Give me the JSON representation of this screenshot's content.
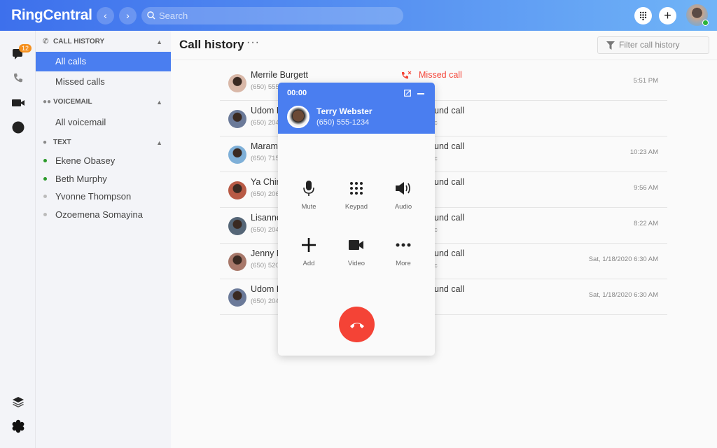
{
  "header": {
    "logo": "RingCentral",
    "search_placeholder": "Search",
    "back_icon": "chevron-left",
    "forward_icon": "chevron-right"
  },
  "rail": {
    "messages_badge": "12"
  },
  "sidebar": {
    "call_history": {
      "label": "CALL HISTORY",
      "items": [
        {
          "label": "All calls",
          "active": true
        },
        {
          "label": "Missed calls"
        }
      ]
    },
    "voicemail": {
      "label": "VOICEMAIL",
      "items": [
        {
          "label": "All voicemail"
        }
      ]
    },
    "text": {
      "label": "TEXT",
      "items": [
        {
          "label": "Ekene Obasey",
          "online": true
        },
        {
          "label": "Beth Murphy",
          "online": true
        },
        {
          "label": "Yvonne Thompson",
          "online": false
        },
        {
          "label": "Ozoemena Somayina",
          "online": false
        }
      ]
    }
  },
  "main": {
    "title": "Call history",
    "filter_placeholder": "Filter call history",
    "rows": [
      {
        "name": "Merrile Burgett",
        "phone": "(650) 555",
        "type": "Missed call",
        "sub": "",
        "time": "5:51 PM"
      },
      {
        "name": "Udom R",
        "phone": "(650) 204",
        "type": "und call",
        "sub": "c",
        "time": ""
      },
      {
        "name": "Maram",
        "phone": "(650) 715",
        "type": "und call",
        "sub": "c",
        "time": "10:23 AM"
      },
      {
        "name": "Ya Chin",
        "phone": "(650) 206",
        "type": "und call",
        "sub": "",
        "time": "9:56 AM"
      },
      {
        "name": "Lisanne",
        "phone": "(650) 204",
        "type": "und call",
        "sub": "c",
        "time": "8:22 AM"
      },
      {
        "name": "Jenny N",
        "phone": "(650) 520",
        "type": "und call",
        "sub": "c",
        "time": "Sat, 1/18/2020 6:30 AM"
      },
      {
        "name": "Udom R",
        "phone": "(650) 204",
        "type": "und call",
        "sub": "",
        "time": "Sat, 1/18/2020 6:30 AM"
      }
    ]
  },
  "call_popup": {
    "timer": "00:00",
    "name": "Terry Webster",
    "phone": "(650) 555-1234",
    "controls": [
      {
        "label": "Mute",
        "icon": "microphone"
      },
      {
        "label": "Keypad",
        "icon": "keypad"
      },
      {
        "label": "Audio",
        "icon": "speaker"
      },
      {
        "label": "Add",
        "icon": "plus"
      },
      {
        "label": "Video",
        "icon": "video-camera"
      },
      {
        "label": "More",
        "icon": "more-dots"
      }
    ]
  },
  "colors": {
    "brand": "#4a7ef0",
    "missed": "#f44336",
    "end_call": "#f44336",
    "badge": "#f5901e",
    "online": "#2bb33a"
  }
}
